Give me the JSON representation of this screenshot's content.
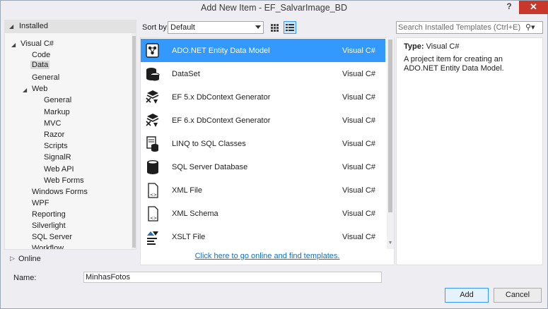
{
  "window": {
    "title": "Add New Item - EF_SalvarImage_BD",
    "help_label": "?",
    "close_label": "✕"
  },
  "left_pane": {
    "installed_label": "Installed",
    "tree": [
      {
        "label": "Visual C#",
        "level": 0,
        "expanded": true
      },
      {
        "label": "Code",
        "level": 1
      },
      {
        "label": "Data",
        "level": 1,
        "selected": true
      },
      {
        "label": "General",
        "level": 1
      },
      {
        "label": "Web",
        "level": 1,
        "expanded": true
      },
      {
        "label": "General",
        "level": 2
      },
      {
        "label": "Markup",
        "level": 2
      },
      {
        "label": "MVC",
        "level": 2
      },
      {
        "label": "Razor",
        "level": 2
      },
      {
        "label": "Scripts",
        "level": 2
      },
      {
        "label": "SignalR",
        "level": 2
      },
      {
        "label": "Web API",
        "level": 2
      },
      {
        "label": "Web Forms",
        "level": 2
      },
      {
        "label": "Windows Forms",
        "level": 1
      },
      {
        "label": "WPF",
        "level": 1
      },
      {
        "label": "Reporting",
        "level": 1
      },
      {
        "label": "Silverlight",
        "level": 1
      },
      {
        "label": "SQL Server",
        "level": 1
      },
      {
        "label": "Workflow",
        "level": 1
      }
    ],
    "online_label": "Online"
  },
  "toolbar": {
    "sort_label": "Sort by:",
    "sort_value": "Default"
  },
  "templates": [
    {
      "name": "ADO.NET Entity Data Model",
      "lang": "Visual C#",
      "icon": "entity-model-icon",
      "selected": true
    },
    {
      "name": "DataSet",
      "lang": "Visual C#",
      "icon": "dataset-icon"
    },
    {
      "name": "EF 5.x DbContext Generator",
      "lang": "Visual C#",
      "icon": "ef-generator-icon"
    },
    {
      "name": "EF 6.x DbContext Generator",
      "lang": "Visual C#",
      "icon": "ef-generator-icon"
    },
    {
      "name": "LINQ to SQL Classes",
      "lang": "Visual C#",
      "icon": "linq-sql-icon"
    },
    {
      "name": "SQL Server Database",
      "lang": "Visual C#",
      "icon": "database-icon"
    },
    {
      "name": "XML File",
      "lang": "Visual C#",
      "icon": "xml-file-icon"
    },
    {
      "name": "XML Schema",
      "lang": "Visual C#",
      "icon": "xml-schema-icon"
    },
    {
      "name": "XSLT File",
      "lang": "Visual C#",
      "icon": "xslt-file-icon"
    }
  ],
  "online_link": "Click here to go online and find templates.",
  "search": {
    "placeholder": "Search Installed Templates (Ctrl+E)"
  },
  "details": {
    "type_label": "Type:",
    "type_value": "Visual C#",
    "description": "A project item for creating an ADO.NET Entity Data Model."
  },
  "name_field": {
    "label": "Name:",
    "value": "MinhasFotos"
  },
  "buttons": {
    "add": "Add",
    "cancel": "Cancel"
  },
  "colors": {
    "selection": "#3399ff",
    "link": "#0e70c0",
    "close": "#c7382b"
  }
}
